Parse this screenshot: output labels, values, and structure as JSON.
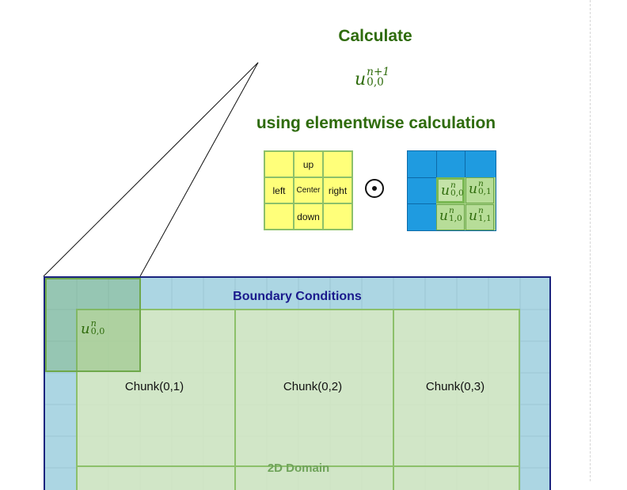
{
  "header": {
    "calculate": "Calculate",
    "target": {
      "base": "u",
      "sup": "n+1",
      "sub": "0,0"
    },
    "method": "using elementwise calculation"
  },
  "stencil": {
    "cells": [
      "",
      "up",
      "",
      "left",
      "Center",
      "right",
      "",
      "down",
      ""
    ],
    "fill_color": "#ffff7a"
  },
  "operator": {
    "symbol": "⊙",
    "icon": "odot-icon"
  },
  "field": {
    "color": "#1f9be0",
    "cells": [
      {
        "base": "u",
        "sup": "n",
        "sub": "0,0"
      },
      {
        "base": "u",
        "sup": "n",
        "sub": "0,1"
      },
      {
        "base": "u",
        "sup": "n",
        "sub": "1,0"
      },
      {
        "base": "u",
        "sup": "n",
        "sub": "1,1"
      }
    ]
  },
  "domain": {
    "boundary_label": "Boundary Conditions",
    "domain_label": "2D Domain",
    "chunks": [
      "Chunk(0,1)",
      "Chunk(0,2)",
      "Chunk(0,3)"
    ],
    "highlight_cell": {
      "base": "u",
      "sup": "n",
      "sub": "0,0"
    },
    "boundary_color": "#acd6e3",
    "inner_color": "#dbeabf"
  }
}
